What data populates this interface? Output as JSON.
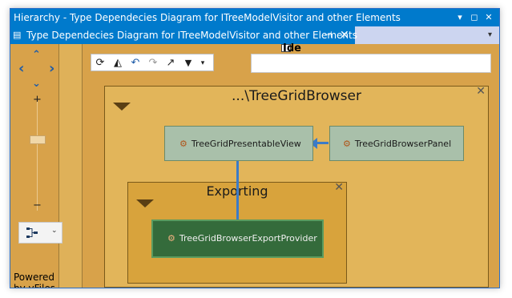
{
  "window": {
    "title": "Hierarchy - Type Dependecies Diagram for ITreeModelVisitor and other Elements",
    "controls": [
      "▾",
      "◻",
      "✕"
    ]
  },
  "tab": {
    "label": "Type Dependecies Diagram for ITreeModelVisitor and other Elements",
    "pin": "⊣",
    "close": "✕",
    "menu": "▾"
  },
  "navigator": {
    "up": "⌃",
    "down": "⌄",
    "left": "‹",
    "right": "›",
    "zoom_in": "+",
    "zoom_out": "−",
    "layout_dropdown": "⌄"
  },
  "toolbar": {
    "refresh": "⟳",
    "layout": "◭",
    "undo": "↶",
    "redo": "↷",
    "export": "↗",
    "filter": "▼",
    "filter_dropdown": "▾"
  },
  "search": {
    "peek_text": "Ide"
  },
  "watermark": "Powered by yFiles",
  "groups": {
    "outer": {
      "title": "...\\TreeGridBrowser",
      "close": "✕"
    },
    "inner": {
      "title": "Exporting",
      "close": "✕"
    }
  },
  "nodes": {
    "presentable_view": "TreeGridPresentableView",
    "browser_panel": "TreeGridBrowserPanel",
    "export_provider": "TreeGridBrowserExportProvider"
  },
  "colors": {
    "accent": "#007acc",
    "canvas": "#d8a24a",
    "group_outer": "#e2b55a",
    "group_inner": "#d8a33c",
    "node_light": "#a9c0aa",
    "node_dark": "#346b3b",
    "edge": "#3b7bc8"
  }
}
